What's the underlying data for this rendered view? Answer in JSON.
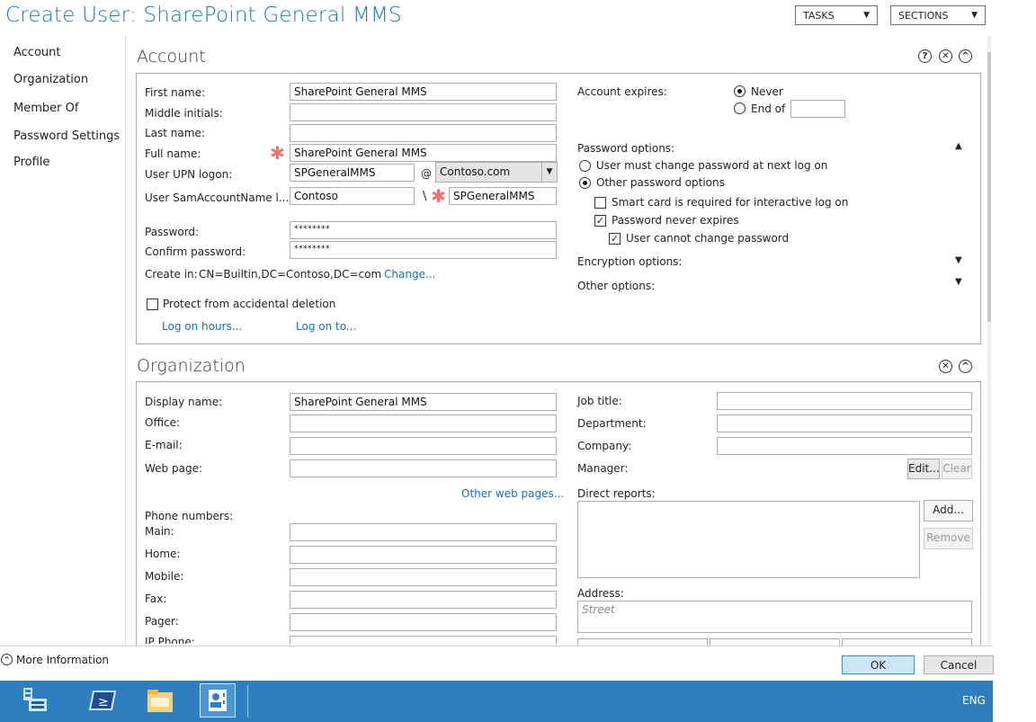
{
  "window": {
    "title": "Create User: SharePoint General MMS",
    "tasks_label": "TASKS",
    "sections_label": "SECTIONS"
  },
  "nav": [
    "Account",
    "Organization",
    "Member Of",
    "Password Settings",
    "Profile"
  ],
  "account": {
    "heading": "Account",
    "first_name_label": "First name:",
    "first_name_value": "SharePoint General MMS",
    "middle_initials_label": "Middle initials:",
    "middle_initials_value": "",
    "last_name_label": "Last name:",
    "last_name_value": "",
    "full_name_label": "Full name:",
    "full_name_value": "SharePoint General MMS",
    "upn_label": "User UPN logon:",
    "upn_value": "SPGeneralMMS",
    "upn_at": "@",
    "upn_domain": "Contoso.com",
    "sam_label": "User SamAccountName l...",
    "sam_domain": "Contoso",
    "sam_sep": "\\",
    "sam_value": "SPGeneralMMS",
    "password_label": "Password:",
    "password_value": "********",
    "confirm_label": "Confirm password:",
    "confirm_value": "********",
    "create_in_label": "Create in:",
    "create_in_value": "CN=Builtin,DC=Contoso,DC=com",
    "change_link": "Change...",
    "protect_label": "Protect from accidental deletion",
    "protect_checked": false,
    "logon_hours_link": "Log on hours...",
    "logon_to_link": "Log on to...",
    "expires_label": "Account expires:",
    "never_label": "Never",
    "endof_label": "End of",
    "endof_value": "",
    "pw_options_label": "Password options:",
    "must_change_label": "User must change password at next log on",
    "other_pw_label": "Other password options",
    "smartcard_label": "Smart card is required for interactive log on",
    "never_expires_label": "Password never expires",
    "cannot_change_label": "User cannot change password",
    "encryption_label": "Encryption options:",
    "other_options_label": "Other options:"
  },
  "organization": {
    "heading": "Organization",
    "display_name_label": "Display name:",
    "display_name_value": "SharePoint General MMS",
    "office_label": "Office:",
    "email_label": "E-mail:",
    "web_label": "Web page:",
    "other_web_link": "Other web pages...",
    "phone_label": "Phone numbers:",
    "main_label": "Main:",
    "home_label": "Home:",
    "mobile_label": "Mobile:",
    "fax_label": "Fax:",
    "pager_label": "Pager:",
    "ipphone_label": "IP Phone:",
    "job_label": "Job title:",
    "dept_label": "Department:",
    "company_label": "Company:",
    "manager_label": "Manager:",
    "edit_btn": "Edit...",
    "clear_btn": "Clear",
    "direct_label": "Direct reports:",
    "add_btn": "Add...",
    "remove_btn": "Remove",
    "address_label": "Address:",
    "street_placeholder": "Street"
  },
  "footer": {
    "more_info": "More Information",
    "ok": "OK",
    "cancel": "Cancel"
  },
  "taskbar": {
    "lang": "ENG"
  },
  "colors": {
    "accent": "#1a79b9",
    "taskbar": "#2f7fc0",
    "required": "#f07070"
  }
}
